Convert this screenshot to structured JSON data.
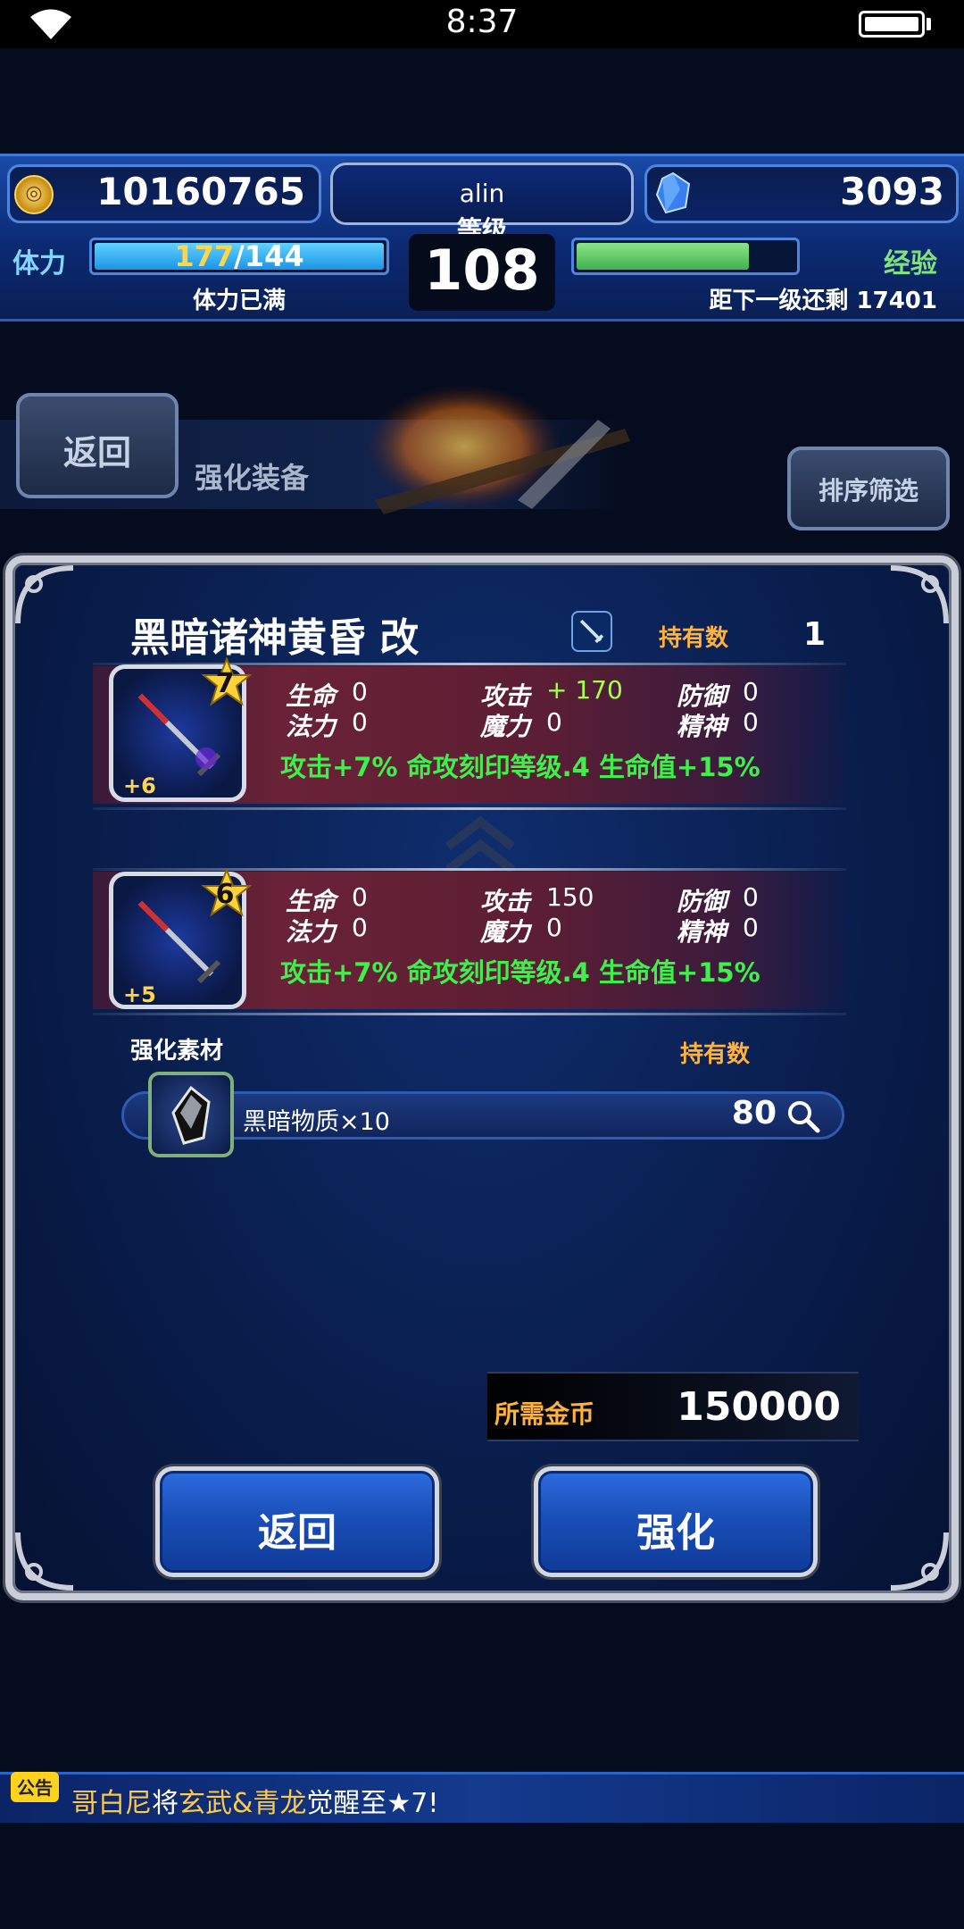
{
  "status_bar": {
    "time": "8:37"
  },
  "header": {
    "gold": "10160765",
    "gems": "3093",
    "player_name": "alin",
    "level_label": "等级",
    "level": "108",
    "stamina_label": "体力",
    "stamina_current": "177",
    "stamina_max": "/144",
    "stamina_status": "体力已满",
    "exp_label": "经验",
    "exp_fill_fraction": 0.79,
    "exp_next_text": "距下一级还剩 17401"
  },
  "nav": {
    "back_label": "返回",
    "title": "强化装备",
    "sort_label": "排序筛选"
  },
  "item": {
    "name": "黑暗诸神黄昏 改",
    "owned_label": "持有数",
    "owned_count": "1",
    "upgraded": {
      "stars": "7",
      "plus": "+6",
      "stats": {
        "hp_label": "生命",
        "hp": "0",
        "atk_label": "攻击",
        "atk": "+ 170",
        "def_label": "防御",
        "def": "0",
        "mp_label": "法力",
        "mp": "0",
        "mag_label": "魔力",
        "mag": "0",
        "spr_label": "精神",
        "spr": "0"
      },
      "bonus": "攻击+7% 命攻刻印等级.4 生命值+15%"
    },
    "current": {
      "stars": "6",
      "plus": "+5",
      "stats": {
        "hp_label": "生命",
        "hp": "0",
        "atk_label": "攻击",
        "atk": "150",
        "def_label": "防御",
        "def": "0",
        "mp_label": "法力",
        "mp": "0",
        "mag_label": "魔力",
        "mag": "0",
        "spr_label": "精神",
        "spr": "0"
      },
      "bonus": "攻击+7% 命攻刻印等级.4 生命值+15%"
    }
  },
  "material": {
    "section_label": "强化素材",
    "owned_label": "持有数",
    "name": "黑暗物质×10",
    "count": "80"
  },
  "cost": {
    "label": "所需金币",
    "value": "150000"
  },
  "buttons": {
    "back": "返回",
    "enhance": "强化"
  },
  "news": {
    "badge": "公告",
    "part1": "哥白尼",
    "part2": "将",
    "part3": "玄武&青龙",
    "part4": "觉醒至★7!"
  },
  "colors": {
    "accent_blue": "#2d6de0",
    "gold_text": "#ffb23c",
    "bonus_green": "#3ef04a",
    "stat_up": "#a6ff4c"
  }
}
